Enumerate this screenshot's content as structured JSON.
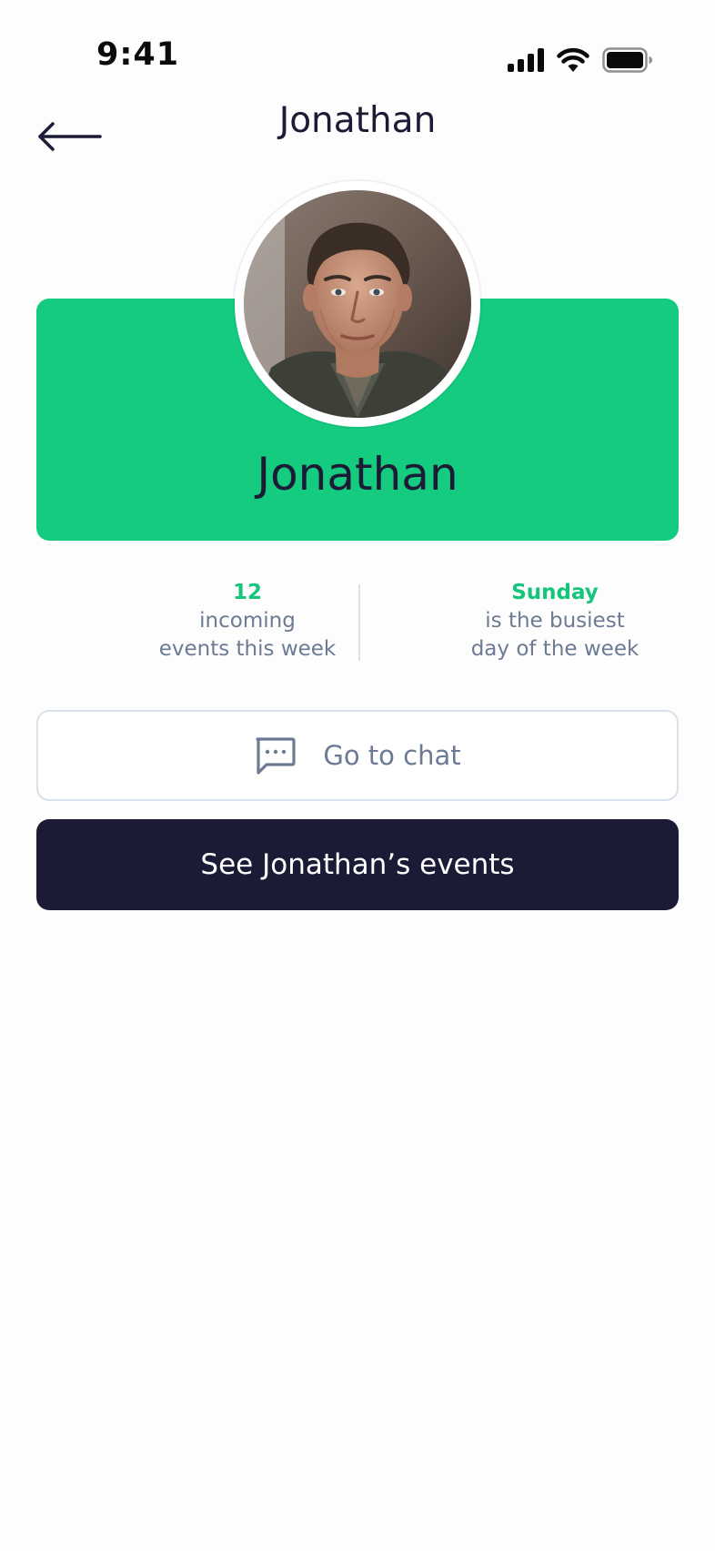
{
  "status_bar": {
    "time": "9:41",
    "icons": [
      "cellular-signal-icon",
      "wifi-icon",
      "battery-icon"
    ]
  },
  "nav": {
    "back_icon": "arrow-left-icon",
    "title": "Jonathan"
  },
  "profile": {
    "name": "Jonathan",
    "avatar_icon": "profile-photo",
    "card_color": "#14cb7f"
  },
  "stats": {
    "incoming": {
      "value": "12",
      "line1": "incoming",
      "line2": "events this week"
    },
    "busiest": {
      "value": "Sunday",
      "line1": "is the busiest",
      "line2": "day of the week"
    }
  },
  "actions": {
    "chat_label": "Go to chat",
    "chat_icon": "chat-bubble-icon",
    "events_label": "See Jonathan’s events"
  },
  "colors": {
    "accent": "#14cb7f",
    "dark": "#1b1b36",
    "muted_text": "#6c7a93",
    "border": "#d7e2ec"
  }
}
